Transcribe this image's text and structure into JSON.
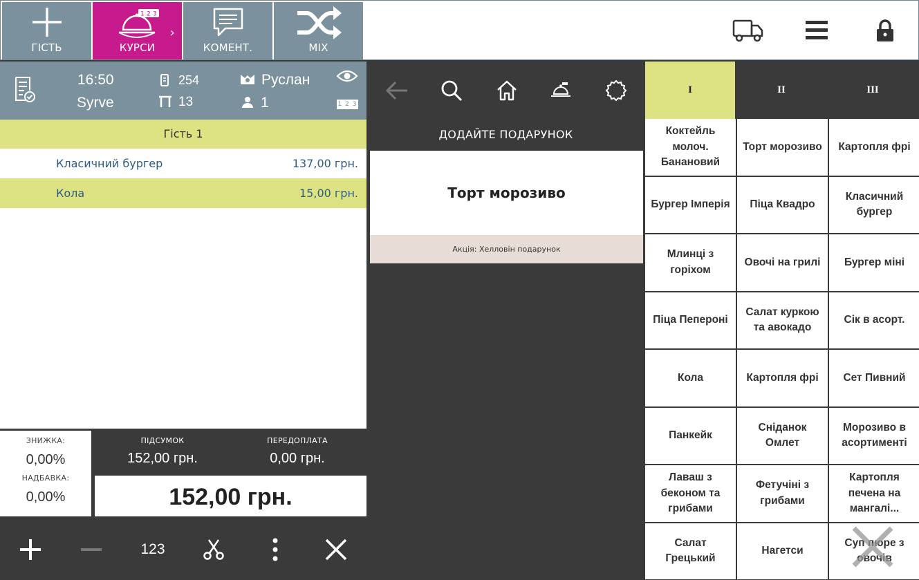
{
  "topbar": {
    "buttons": [
      {
        "label": "ГІСТЬ",
        "icon": "plus-icon"
      },
      {
        "label": "КУРСИ",
        "icon": "cloche-courses-icon",
        "badge": "1 2 3",
        "active": true
      },
      {
        "label": "КОМЕНТ.",
        "icon": "comment-icon"
      },
      {
        "label": "MIX",
        "icon": "shuffle-icon"
      }
    ],
    "right_icons": [
      "delivery-truck-icon",
      "menu-icon",
      "lock-icon"
    ],
    "accent": "#c71a8c"
  },
  "order": {
    "time": "16:50",
    "restaurant": "Syrve",
    "order_number": "254",
    "table": "13",
    "waiter": "Руслан",
    "guests": "1",
    "badge": "1 2 3",
    "guest_label": "Гість 1",
    "items": [
      {
        "name": "Класичний бургер",
        "price": "137,00 грн."
      },
      {
        "name": "Кола",
        "price": "15,00 грн."
      }
    ]
  },
  "totals": {
    "discount_label": "ЗНИЖКА:",
    "discount_value": "0,00%",
    "markup_label": "НАДБАВКА:",
    "markup_value": "0,00%",
    "subtotal_label": "ПІДСУМОК",
    "subtotal_value": "152,00 грн.",
    "prepay_label": "ПЕРЕДОПЛАТА",
    "prepay_value": "0,00 грн.",
    "total": "152,00 грн."
  },
  "bottom": {
    "quantity_label": "123"
  },
  "gift": {
    "title": "ДОДАЙТЕ ПОДАРУНОК",
    "item": "Торт морозиво",
    "promo": "Акція: Хелловін подарунок"
  },
  "courses": {
    "tabs": [
      "I",
      "II",
      "III"
    ],
    "active_color": "#dde283"
  },
  "products": [
    "Коктейль молоч. Банановий",
    "Торт морозиво",
    "Картопля фрі",
    "Бургер Імперія",
    "Піца Квадро",
    "Класичний бургер",
    "Млинці з горіхом",
    "Овочі на грилі",
    "Бургер міні",
    "Піца Пепероні",
    "Салат куркою та авокадо",
    "Сік в асорт.",
    "Кола",
    "Картопля фрі",
    "Сет Пивний",
    "Панкейк",
    "Сніданок Омлет",
    "Морозиво в асортименті",
    "Лаваш з беконом та грибами",
    "Фетучіні з грибами",
    "Картопля печена на мангалі...",
    "Салат Грецький",
    "Нагетси",
    "Суп пюре з овочів"
  ]
}
